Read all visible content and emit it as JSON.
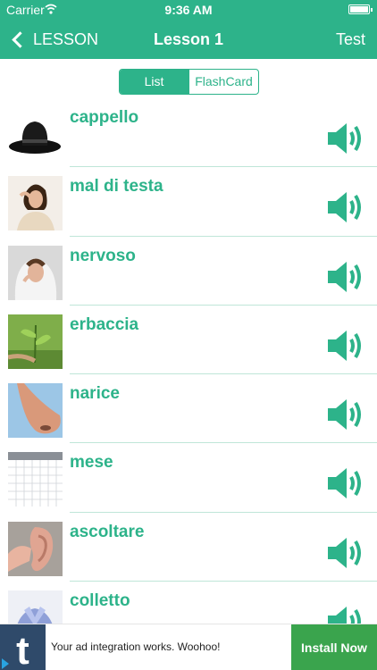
{
  "status_bar": {
    "carrier": "Carrier",
    "time": "9:36 AM"
  },
  "nav": {
    "back_label": "LESSON",
    "title": "Lesson 1",
    "right_label": "Test"
  },
  "segment": {
    "list_label": "List",
    "flashcard_label": "FlashCard",
    "selected": "List"
  },
  "words": [
    {
      "word": "cappello",
      "image_icon": "hat-image"
    },
    {
      "word": "mal di testa",
      "image_icon": "headache-image"
    },
    {
      "word": "nervoso",
      "image_icon": "nervous-person-image"
    },
    {
      "word": "erbaccia",
      "image_icon": "weed-image"
    },
    {
      "word": "narice",
      "image_icon": "nose-image"
    },
    {
      "word": "mese",
      "image_icon": "calendar-image"
    },
    {
      "word": "ascoltare",
      "image_icon": "ear-image"
    },
    {
      "word": "colletto",
      "image_icon": "collar-image"
    }
  ],
  "ad": {
    "text": "Your ad integration works. Woohoo!",
    "button": "Install Now",
    "logo_letter": "t"
  },
  "colors": {
    "accent": "#2db38a",
    "ad_button": "#3aa44d",
    "ad_logo": "#2f4a6a"
  }
}
